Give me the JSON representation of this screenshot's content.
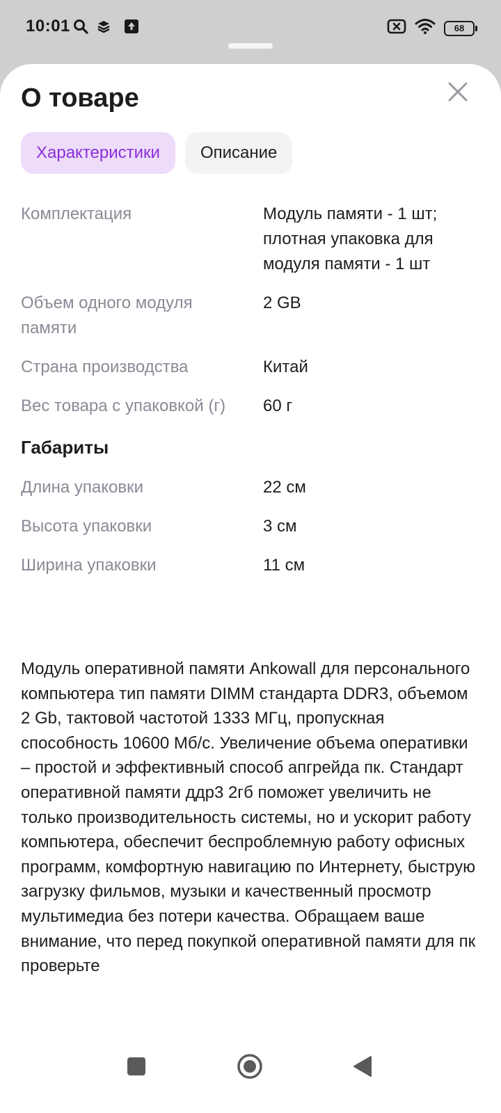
{
  "status_bar": {
    "time": "10:01",
    "battery": "68",
    "icons_left": [
      "search-icon",
      "layers-icon",
      "upload-icon"
    ],
    "icons_right": [
      "sim-off-icon",
      "wifi-icon",
      "battery-icon"
    ]
  },
  "sheet": {
    "title": "О товаре",
    "close_icon": "close-icon"
  },
  "tabs": [
    {
      "label": "Характеристики",
      "active": true
    },
    {
      "label": "Описание",
      "active": false
    }
  ],
  "specs": [
    {
      "name": "Комплектация",
      "value": "Модуль памяти - 1 шт; плотная упаковка для модуля памяти - 1 шт"
    },
    {
      "name": "Объем одного модуля памяти",
      "value": "2 GB"
    },
    {
      "name": "Страна производства",
      "value": "Китай"
    },
    {
      "name": "Вес товара с упаковкой (г)",
      "value": "60 г"
    }
  ],
  "dimensions": {
    "heading": "Габариты",
    "rows": [
      {
        "name": "Длина упаковки",
        "value": "22 см"
      },
      {
        "name": "Высота упаковки",
        "value": "3 см"
      },
      {
        "name": "Ширина упаковки",
        "value": "11 см"
      }
    ]
  },
  "description": "Модуль оперативной памяти Ankowall для персонального компьютера тип памяти DIMM стандарта DDR3, объемом 2 Gb, тактовой частотой 1333 МГц, пропускная способность 10600 Мб/с. Увеличение объема оперативки – простой и эффективный способ апгрейда пк. Стандарт оперативной памяти ддр3 2гб поможет увеличить не только производительность системы, но и ускорит работу компьютера, обеспечит беспроблемную работу офисных программ, комфортную навигацию по Интернету, быструю загрузку фильмов, музыки и качественный просмотр мультимедиа без потери качества. Обращаем ваше внимание, что перед покупкой оперативной памяти для пк проверьте",
  "nav_bar": {
    "buttons": [
      "recents-button",
      "home-button",
      "back-button"
    ]
  },
  "colors": {
    "accent": "#8b2fd9",
    "accent_bg": "#eedcfb",
    "muted_text": "#8a8a96",
    "text": "#1d1d1f"
  }
}
